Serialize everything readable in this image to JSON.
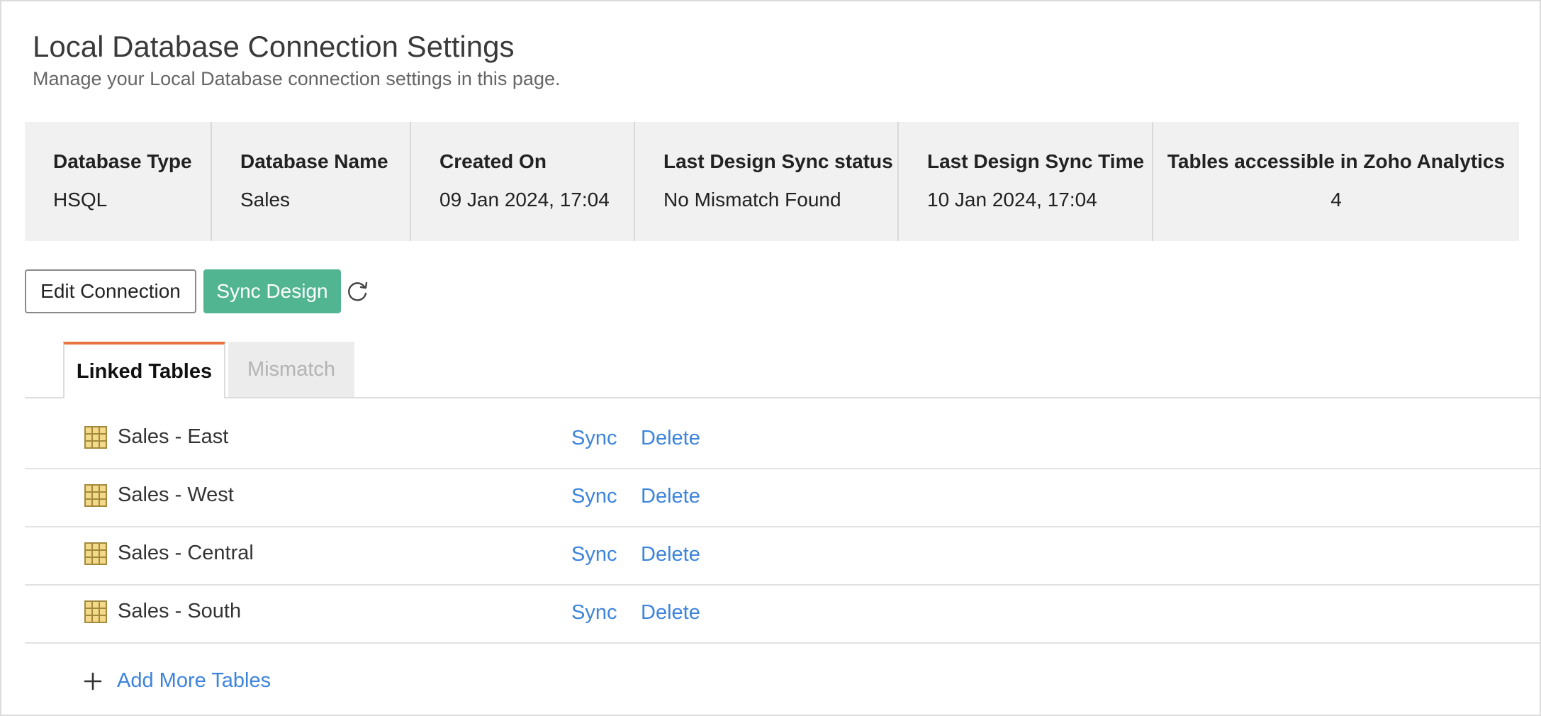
{
  "header": {
    "title": "Local Database Connection Settings",
    "subtitle": "Manage your Local Database connection settings in this page."
  },
  "info": [
    {
      "label": "Database Type",
      "value": "HSQL"
    },
    {
      "label": "Database Name",
      "value": "Sales"
    },
    {
      "label": "Created On",
      "value": "09 Jan 2024, 17:04"
    },
    {
      "label": "Last Design Sync status",
      "value": "No Mismatch Found"
    },
    {
      "label": "Last Design Sync Time",
      "value": "10 Jan 2024, 17:04"
    },
    {
      "label": "Tables accessible in Zoho Analytics",
      "value": "4"
    }
  ],
  "actions": {
    "edit_label": "Edit Connection",
    "sync_label": "Sync Design",
    "refresh_icon": "refresh-icon"
  },
  "tabs": [
    {
      "label": "Linked Tables",
      "active": true
    },
    {
      "label": "Mismatch",
      "active": false
    }
  ],
  "tables": [
    {
      "name": "Sales - East",
      "sync": "Sync",
      "delete": "Delete",
      "icon": "table-icon"
    },
    {
      "name": "Sales - West",
      "sync": "Sync",
      "delete": "Delete",
      "icon": "table-icon"
    },
    {
      "name": "Sales - Central",
      "sync": "Sync",
      "delete": "Delete",
      "icon": "table-icon"
    },
    {
      "name": "Sales - South",
      "sync": "Sync",
      "delete": "Delete",
      "icon": "table-icon"
    }
  ],
  "add_more_label": "Add More Tables",
  "colors": {
    "accent_green": "#52b591",
    "link_blue": "#3d84dc",
    "tab_active_border": "#e8733f",
    "info_bar_bg": "#f1f1f1"
  }
}
